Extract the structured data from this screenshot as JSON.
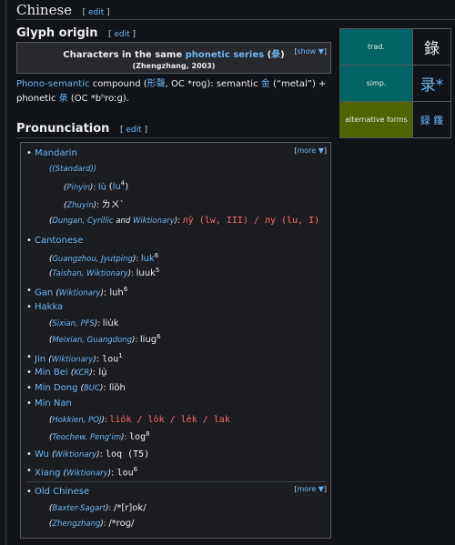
{
  "header": {
    "title": "Chinese",
    "edit": "edit"
  },
  "glyph": {
    "title": "Glyph origin",
    "edit": "edit",
    "box_title_a": "Characters in the same ",
    "box_title_link": "phonetic series",
    "box_title_b": " (",
    "box_title_char": "彔",
    "box_title_c": ")",
    "box_sub": "(Zhengzhang, 2003)",
    "show": "show ▼",
    "p1_link": "Phono-semantic",
    "p1_a": " compound (",
    "p1_char": "形聲",
    "p1_b": ", OC *roɡ): semantic ",
    "p1_char2": "金",
    "p1_c": " (“metal”) +",
    "p2_a": "phonetic ",
    "p2_char": "彔",
    "p2_b": " (OC *bʰroːɡ)."
  },
  "side": {
    "rows": [
      {
        "label": "trad.",
        "value": "錄",
        "color": "#006464"
      },
      {
        "label": "simp.",
        "value": "录*",
        "color": "#006464"
      },
      {
        "label": "alternative forms",
        "value": "録 𨯿",
        "color": "#4f6400"
      }
    ]
  },
  "pron": {
    "title": "Pronunciation",
    "edit": "edit",
    "more": "more ▼",
    "mandarin": "Mandarin",
    "standard": "(Standard)",
    "pinyin_lab": "Pinyin",
    "pinyin_val": "lù",
    "pinyin_alt": "lu",
    "zhuyin_lab": "Zhuyin",
    "zhuyin_val": "ㄌㄨˋ",
    "dungan_lab_a": "Dungan, Cyrillic",
    "dungan_lab_b": " and ",
    "dungan_lab_c": "Wiktionary",
    "dungan_val": "лў (lw, III) / лу (lu, I)",
    "cantonese": "Cantonese",
    "guangzhou_lab": "Guangzhou, Jyutping",
    "guangzhou_val": "luk",
    "taishan_lab": "Taishan, Wiktionary",
    "taishan_val": "luuk",
    "gan": "Gan",
    "gan_lab": "Wiktionary",
    "gan_val": "luh",
    "hakka": "Hakka",
    "sixian_lab": "Sixian, PFS",
    "sixian_val": "liu̍k",
    "meixian_lab": "Meixian, Guangdong",
    "meixian_val": "liug",
    "jin": "Jin",
    "jin_lab": "Wiktionary",
    "jin_val": "lou",
    "minbei": "Min Bei",
    "minbei_lab": "KCR",
    "minbei_val": "lṳ̀",
    "mindong": "Min Dong",
    "mindong_lab": "BUC",
    "mindong_val": "lĭŏh",
    "minnan": "Min Nan",
    "hokkien_lab": "Hokkien, POJ",
    "hokkien_val": "lio̍k / lo̍k / le̍k / lak",
    "teochew_lab": "Teochew, Peng'im",
    "teochew_val": "log",
    "wu": "Wu",
    "wu_lab": "Wiktionary",
    "wu_val": "loq (T5)",
    "xiang": "Xiang",
    "xiang_lab": "Wiktionary",
    "xiang_val": "lou",
    "oldchinese": "Old Chinese",
    "more2": "more ▼",
    "baxter_lab": "Baxter-Sagart",
    "baxter_val": "/*[r]ok/",
    "zhengzhang_lab": "Zhengzhang",
    "zhengzhang_val": "/*roɡ/",
    "sup4": "4",
    "sup6": "6",
    "sup5": "5",
    "sup1": "1",
    "sup8": "8"
  }
}
